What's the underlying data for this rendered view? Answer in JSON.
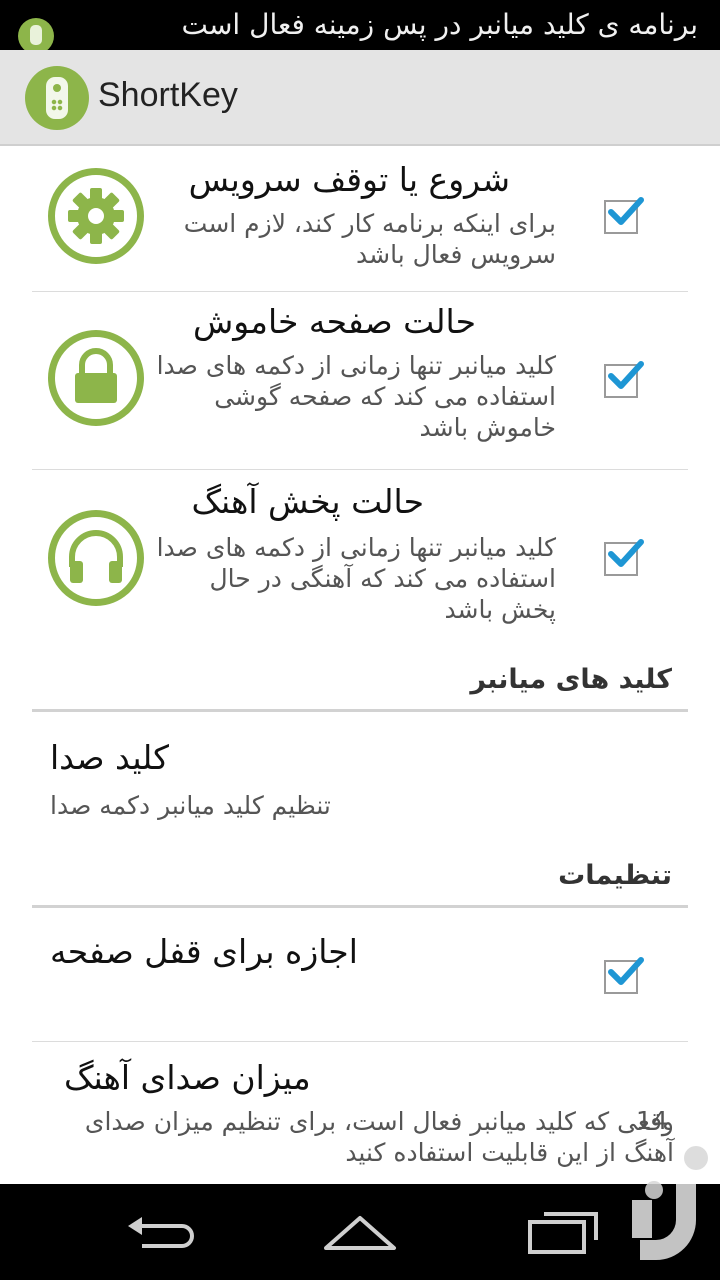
{
  "status_bar": {
    "ticker_text": "برنامه ی کلید میانبر در پس زمینه فعال است"
  },
  "action_bar": {
    "title": "ShortKey",
    "logo_icon": "remote-control-icon",
    "accent_color": "#8db54a"
  },
  "preferences": [
    {
      "icon": "gear-icon",
      "title": "شروع یا توقف سرویس",
      "summary": "برای اینکه برنامه کار کند، لازم است سرویس فعال باشد",
      "checked": true
    },
    {
      "icon": "lock-icon",
      "title": "حالت صفحه خاموش",
      "summary": "کلید میانبر تنها زمانی از دکمه های صدا استفاده می کند که صفحه گوشی خاموش باشد",
      "checked": true
    },
    {
      "icon": "headphones-icon",
      "title": "حالت پخش آهنگ",
      "summary": "کلید میانبر تنها زمانی از دکمه های صدا استفاده می کند که آهنگی در حال پخش باشد",
      "checked": true
    }
  ],
  "shortcuts_section": {
    "header": "کلید های میانبر",
    "volume_key": {
      "title": "کلید صدا",
      "summary": "تنظیم کلید میانبر دکمه صدا"
    }
  },
  "settings_section": {
    "header": "تنظیمات",
    "allow_lock": {
      "title": "اجازه برای قفل صفحه",
      "checked": true
    },
    "music_volume": {
      "title": "میزان صدای آهنگ",
      "summary": "وقعی که کلید میانبر فعال است، برای تنظیم میزان صدای آهنگ از این قابلیت استفاده کنید",
      "value": "14"
    }
  },
  "nav_bar": {
    "back_icon": "back-icon",
    "home_icon": "home-icon",
    "recents_icon": "recent-apps-icon"
  },
  "checkbox_color": "#1e96d4"
}
